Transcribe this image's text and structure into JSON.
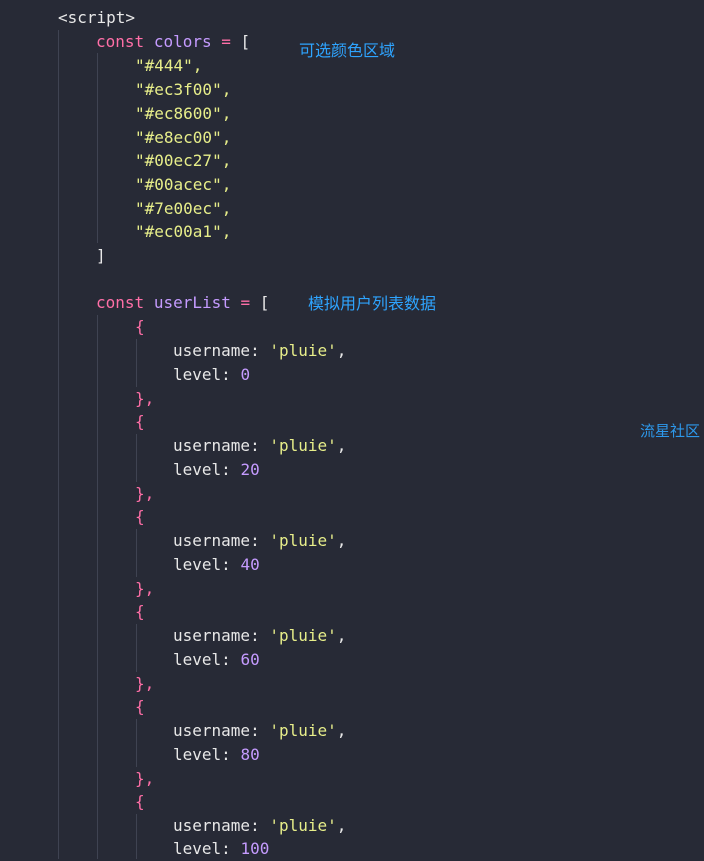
{
  "code": {
    "script_open": "<script>",
    "const_keyword": "const",
    "colors_var": "colors",
    "assign": "=",
    "open_bracket": "[",
    "close_bracket": "]",
    "colors": [
      "\"#444\",",
      "\"#ec3f00\",",
      "\"#ec8600\",",
      "\"#e8ec00\",",
      "\"#00ec27\",",
      "\"#00acec\",",
      "\"#7e00ec\",",
      "\"#ec00a1\","
    ],
    "userlist_var": "userList",
    "open_brace": "{",
    "close_brace": "},",
    "username_key": "username",
    "level_key": "level",
    "colon": ":",
    "comma": ",",
    "users": [
      {
        "username": "'pluie'",
        "level": "0"
      },
      {
        "username": "'pluie'",
        "level": "20"
      },
      {
        "username": "'pluie'",
        "level": "40"
      },
      {
        "username": "'pluie'",
        "level": "60"
      },
      {
        "username": "'pluie'",
        "level": "80"
      },
      {
        "username": "'pluie'",
        "level": "100"
      }
    ]
  },
  "annotations": {
    "colors_note": "可选颜色区域",
    "userlist_note": "模拟用户列表数据",
    "watermark": "流星社区"
  },
  "theme": {
    "background": "#272a36",
    "keyword": "#ff6fa7",
    "string": "#e7ee8a",
    "number": "#c59bff",
    "annotation": "#2ea4ff"
  }
}
